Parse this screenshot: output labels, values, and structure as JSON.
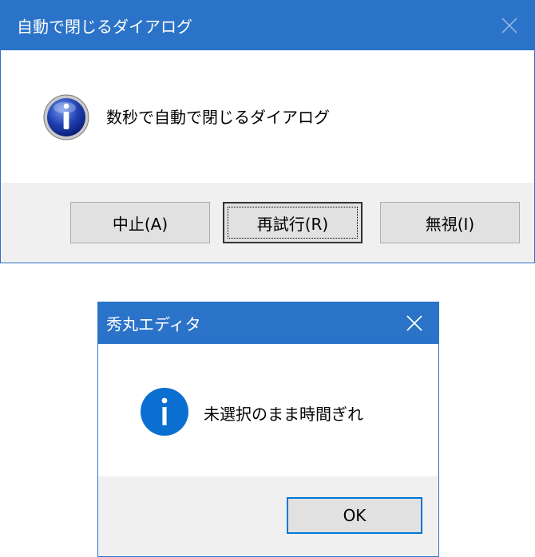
{
  "dialog1": {
    "title": "自動で閉じるダイアログ",
    "message": "数秒で自動で閉じるダイアログ",
    "icon": "information-icon",
    "buttons": {
      "abort_label": "中止(A)",
      "retry_label": "再試行(R)",
      "ignore_label": "無視(I)"
    },
    "close_icon": "close-icon",
    "close_enabled": false
  },
  "dialog2": {
    "title": "秀丸エディタ",
    "message": "未選択のまま時間ぎれ",
    "icon": "information-icon",
    "buttons": {
      "ok_label": "OK"
    },
    "close_icon": "close-icon",
    "close_enabled": true
  },
  "colors": {
    "titlebar": "#2b73c8",
    "footer": "#f0f0f0",
    "button_face": "#e1e1e1",
    "focus_border": "#0078d7"
  }
}
